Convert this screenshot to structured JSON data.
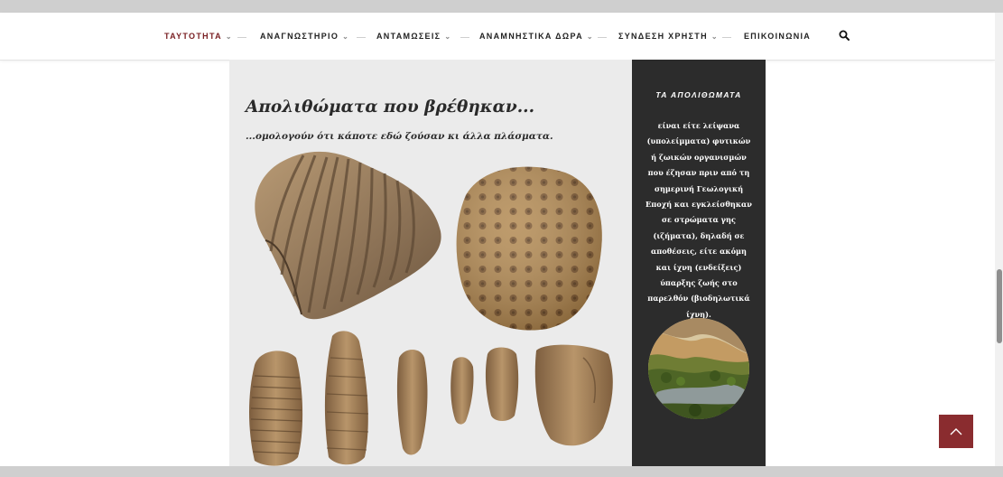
{
  "nav": {
    "items": [
      {
        "label": "ΤΑΥΤΟΤΗΤΑ",
        "dropdown": true,
        "active": true
      },
      {
        "label": "ΑΝΑΓΝΩΣΤΗΡΙΟ",
        "dropdown": true,
        "active": false
      },
      {
        "label": "ΑΝΤΑΜΩΣΕΙΣ",
        "dropdown": true,
        "active": false
      },
      {
        "label": "ΑΝΑΜΝΗΣΤΙΚΑ ΔΩΡΑ",
        "dropdown": true,
        "active": false
      },
      {
        "label": "ΣΥΝΔΕΣΗ ΧΡΗΣΤΗ",
        "dropdown": true,
        "active": false
      },
      {
        "label": "ΕΠΙΚΟΙΝΩΝΙΑ",
        "dropdown": false,
        "active": false
      }
    ],
    "dropdown_glyph": "⌄",
    "search_icon": "search-icon",
    "active_color": "#7a2024"
  },
  "main": {
    "title": "Απολιθώματα που βρέθηκαν...",
    "subtitle": "...ομολογούν ότι κάποτε εδώ ζούσαν κι άλλα πλάσματα."
  },
  "sidebar": {
    "heading": "ΤΑ ΑΠΟΛΙΘΩΜΑΤΑ",
    "text": "είναι είτε λείψανα (υπολείμματα) φυτικών ή ζωικών οργανισμών που έζησαν πριν από τη σημερινή Γεωλογική Εποχή και εγκλείσθηκαν σε στρώματα γης (ιζήματα), δηλαδή σε αποθέσεις, είτε ακόμη και ίχνη (ενδείξεις) ύπαρξης ζωής στο παρελθόν (βιοδηλωτικά ίχνη).",
    "background": "#2c2c2c"
  },
  "back_to_top": {
    "icon": "chevron-up-icon",
    "color": "#8a2c2f"
  }
}
